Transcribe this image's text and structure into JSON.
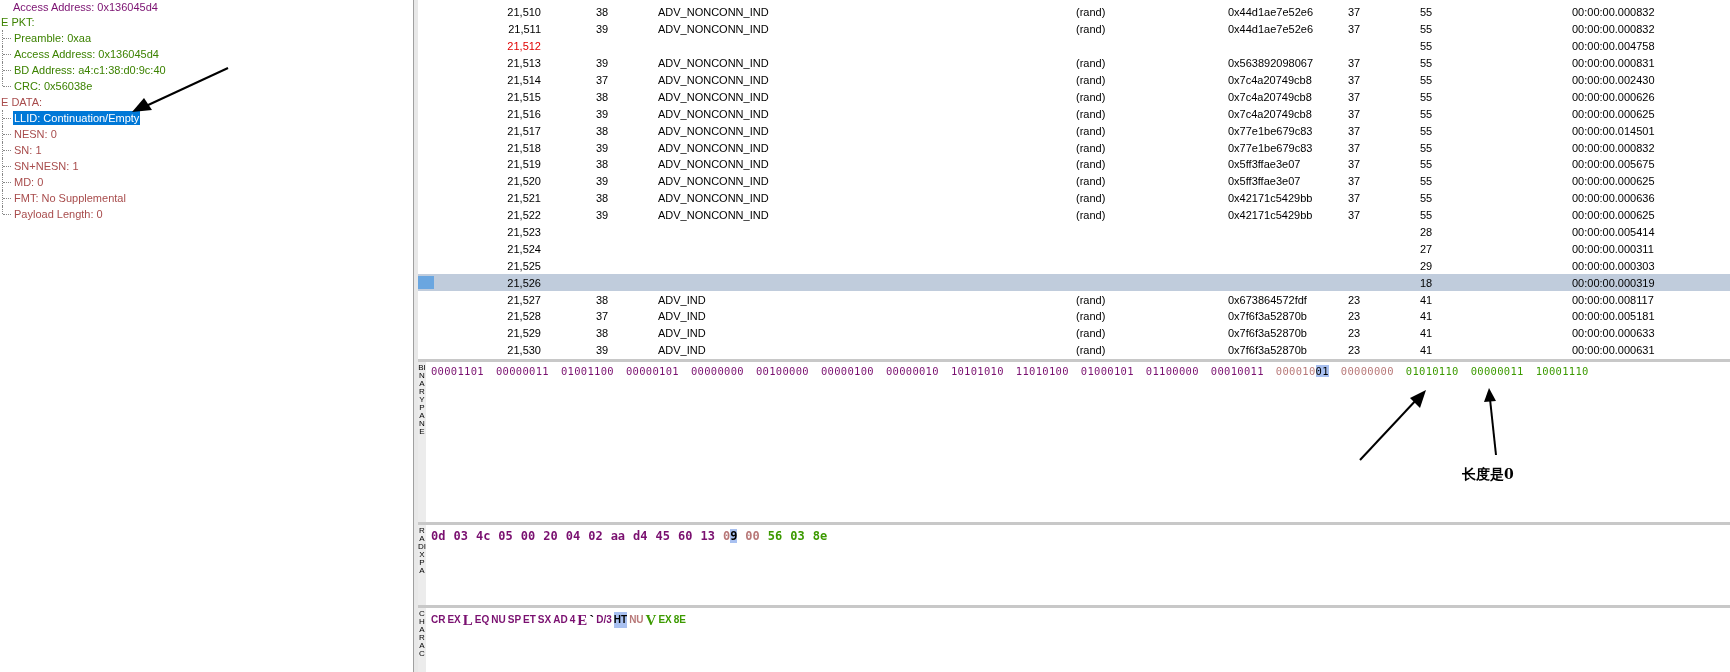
{
  "tree": [
    {
      "label": "Access Address: 0x136045d4",
      "color": "#7a1070",
      "selected": false
    },
    {
      "label": "E PKT:",
      "color": "#3c8200",
      "selected": false,
      "children": [
        {
          "label": "Preamble: 0xaa",
          "color": "#3c8200",
          "selected": false
        },
        {
          "label": "Access Address: 0x136045d4",
          "color": "#3c8200",
          "selected": false
        },
        {
          "label": "BD Address: a4:c1:38:d0:9c:40",
          "color": "#3c8200",
          "selected": false
        },
        {
          "label": "CRC: 0x56038e",
          "color": "#3c8200",
          "selected": false
        }
      ]
    },
    {
      "label": "E DATA:",
      "color": "#a84c4c",
      "selected": false,
      "children": [
        {
          "label": "LLID: Continuation/Empty",
          "selected": true
        },
        {
          "label": "NESN: 0",
          "color": "#a84c4c",
          "selected": false
        },
        {
          "label": "SN: 1",
          "color": "#a84c4c",
          "selected": false
        },
        {
          "label": "SN+NESN: 1",
          "color": "#a84c4c",
          "selected": false
        },
        {
          "label": "MD: 0",
          "color": "#a84c4c",
          "selected": false
        },
        {
          "label": "FMT: No Supplemental",
          "color": "#a84c4c",
          "selected": false
        },
        {
          "label": "Payload Length: 0",
          "color": "#a84c4c",
          "selected": false
        }
      ]
    }
  ],
  "table": {
    "rows": [
      {
        "index": "21,510",
        "column_2": "38",
        "pdu": "ADV_NONCONN_IND",
        "addr_type": "(rand)",
        "address": "0x44d1ae7e52e6",
        "column_6": "37",
        "column_7": "55",
        "time": "00:00:00.000832",
        "flagged": false,
        "selected": false
      },
      {
        "index": "21,511",
        "column_2": "39",
        "pdu": "ADV_NONCONN_IND",
        "addr_type": "(rand)",
        "address": "0x44d1ae7e52e6",
        "column_6": "37",
        "column_7": "55",
        "time": "00:00:00.000832",
        "flagged": false,
        "selected": false
      },
      {
        "index": "21,512",
        "column_7": "55",
        "time": "00:00:00.004758",
        "flagged": true,
        "selected": false
      },
      {
        "index": "21,513",
        "column_2": "39",
        "pdu": "ADV_NONCONN_IND",
        "addr_type": "(rand)",
        "address": "0x563892098067",
        "column_6": "37",
        "column_7": "55",
        "time": "00:00:00.000831",
        "flagged": false,
        "selected": false
      },
      {
        "index": "21,514",
        "column_2": "37",
        "pdu": "ADV_NONCONN_IND",
        "addr_type": "(rand)",
        "address": "0x7c4a20749cb8",
        "column_6": "37",
        "column_7": "55",
        "time": "00:00:00.002430",
        "flagged": false,
        "selected": false
      },
      {
        "index": "21,515",
        "column_2": "38",
        "pdu": "ADV_NONCONN_IND",
        "addr_type": "(rand)",
        "address": "0x7c4a20749cb8",
        "column_6": "37",
        "column_7": "55",
        "time": "00:00:00.000626",
        "flagged": false,
        "selected": false
      },
      {
        "index": "21,516",
        "column_2": "39",
        "pdu": "ADV_NONCONN_IND",
        "addr_type": "(rand)",
        "address": "0x7c4a20749cb8",
        "column_6": "37",
        "column_7": "55",
        "time": "00:00:00.000625",
        "flagged": false,
        "selected": false
      },
      {
        "index": "21,517",
        "column_2": "38",
        "pdu": "ADV_NONCONN_IND",
        "addr_type": "(rand)",
        "address": "0x77e1be679c83",
        "column_6": "37",
        "column_7": "55",
        "time": "00:00:00.014501",
        "flagged": false,
        "selected": false
      },
      {
        "index": "21,518",
        "column_2": "39",
        "pdu": "ADV_NONCONN_IND",
        "addr_type": "(rand)",
        "address": "0x77e1be679c83",
        "column_6": "37",
        "column_7": "55",
        "time": "00:00:00.000832",
        "flagged": false,
        "selected": false
      },
      {
        "index": "21,519",
        "column_2": "38",
        "pdu": "ADV_NONCONN_IND",
        "addr_type": "(rand)",
        "address": "0x5ff3ffae3e07",
        "column_6": "37",
        "column_7": "55",
        "time": "00:00:00.005675",
        "flagged": false,
        "selected": false
      },
      {
        "index": "21,520",
        "column_2": "39",
        "pdu": "ADV_NONCONN_IND",
        "addr_type": "(rand)",
        "address": "0x5ff3ffae3e07",
        "column_6": "37",
        "column_7": "55",
        "time": "00:00:00.000625",
        "flagged": false,
        "selected": false
      },
      {
        "index": "21,521",
        "column_2": "38",
        "pdu": "ADV_NONCONN_IND",
        "addr_type": "(rand)",
        "address": "0x42171c5429bb",
        "column_6": "37",
        "column_7": "55",
        "time": "00:00:00.000636",
        "flagged": false,
        "selected": false
      },
      {
        "index": "21,522",
        "column_2": "39",
        "pdu": "ADV_NONCONN_IND",
        "addr_type": "(rand)",
        "address": "0x42171c5429bb",
        "column_6": "37",
        "column_7": "55",
        "time": "00:00:00.000625",
        "flagged": false,
        "selected": false
      },
      {
        "index": "21,523",
        "column_7": "28",
        "time": "00:00:00.005414",
        "flagged": false,
        "selected": false
      },
      {
        "index": "21,524",
        "column_7": "27",
        "time": "00:00:00.000311",
        "flagged": false,
        "selected": false
      },
      {
        "index": "21,525",
        "column_7": "29",
        "time": "00:00:00.000303",
        "flagged": false,
        "selected": false
      },
      {
        "index": "21,526",
        "column_7": "18",
        "time": "00:00:00.000319",
        "flagged": false,
        "selected": true
      },
      {
        "index": "21,527",
        "column_2": "38",
        "pdu": "ADV_IND",
        "addr_type": "(rand)",
        "address": "0x673864572fdf",
        "column_6": "23",
        "column_7": "41",
        "time": "00:00:00.008117",
        "flagged": false,
        "selected": false
      },
      {
        "index": "21,528",
        "column_2": "37",
        "pdu": "ADV_IND",
        "addr_type": "(rand)",
        "address": "0x7f6f3a52870b",
        "column_6": "23",
        "column_7": "41",
        "time": "00:00:00.005181",
        "flagged": false,
        "selected": false
      },
      {
        "index": "21,529",
        "column_2": "38",
        "pdu": "ADV_IND",
        "addr_type": "(rand)",
        "address": "0x7f6f3a52870b",
        "column_6": "23",
        "column_7": "41",
        "time": "00:00:00.000633",
        "flagged": false,
        "selected": false
      },
      {
        "index": "21,530",
        "column_2": "39",
        "pdu": "ADV_IND",
        "addr_type": "(rand)",
        "address": "0x7f6f3a52870b",
        "column_6": "23",
        "column_7": "41",
        "time": "00:00:00.000631",
        "flagged": false,
        "selected": false
      }
    ]
  },
  "binary_pane": {
    "label": "BINARY PANE",
    "bytes": [
      {
        "text": "00001101",
        "color": "#7a1070"
      },
      {
        "text": "00000011",
        "color": "#7a1070"
      },
      {
        "text": "01001100",
        "color": "#7a1070"
      },
      {
        "text": "00000101",
        "color": "#7a1070"
      },
      {
        "text": "00000000",
        "color": "#7a1070"
      },
      {
        "text": "00100000",
        "color": "#7a1070"
      },
      {
        "text": "00000100",
        "color": "#7a1070"
      },
      {
        "text": "00000010",
        "color": "#7a1070"
      },
      {
        "text": "10101010",
        "color": "#7a1070"
      },
      {
        "text": "11010100",
        "color": "#7a1070"
      },
      {
        "text": "01000101",
        "color": "#7a1070"
      },
      {
        "text": "01100000",
        "color": "#7a1070"
      },
      {
        "text": "00010011",
        "color": "#7a1070"
      },
      {
        "text": "000010",
        "highlight": "01",
        "color": "#b87878"
      },
      {
        "text": "00000000",
        "color": "#b87878"
      },
      {
        "text": "01010110",
        "color": "#3c9a00"
      },
      {
        "text": "00000011",
        "color": "#3c9a00"
      },
      {
        "text": "10001110",
        "color": "#3c9a00"
      }
    ],
    "annotation": "长度是0"
  },
  "radix_pane": {
    "label": "RADIX PA",
    "bytes": [
      {
        "text": "0d",
        "color": "#7a1070"
      },
      {
        "text": "03",
        "color": "#7a1070"
      },
      {
        "text": "4c",
        "color": "#7a1070"
      },
      {
        "text": "05",
        "color": "#7a1070"
      },
      {
        "text": "00",
        "color": "#7a1070"
      },
      {
        "text": "20",
        "color": "#7a1070"
      },
      {
        "text": "04",
        "color": "#7a1070"
      },
      {
        "text": "02",
        "color": "#7a1070"
      },
      {
        "text": "aa",
        "color": "#7a1070"
      },
      {
        "text": "d4",
        "color": "#7a1070"
      },
      {
        "text": "45",
        "color": "#7a1070"
      },
      {
        "text": "60",
        "color": "#7a1070"
      },
      {
        "text": "13",
        "color": "#7a1070"
      },
      {
        "text": "0",
        "highlight": "9",
        "color": "#b87878"
      },
      {
        "text": "00",
        "color": "#b87878"
      },
      {
        "text": "56",
        "color": "#3c9a00"
      },
      {
        "text": "03",
        "color": "#3c9a00"
      },
      {
        "text": "8e",
        "color": "#3c9a00"
      }
    ]
  },
  "character_pane": {
    "label": "CHARAC",
    "glyphs": [
      {
        "text": "CR",
        "kind": "ctl",
        "color": "#7a1070"
      },
      {
        "text": "EX",
        "kind": "ctl",
        "color": "#7a1070"
      },
      {
        "text": "L",
        "kind": "chr",
        "color": "#7a1070"
      },
      {
        "text": "EQ",
        "kind": "ctl",
        "color": "#7a1070"
      },
      {
        "text": "NU",
        "kind": "ctl",
        "color": "#7a1070"
      },
      {
        "text": "SP",
        "kind": "ctl",
        "color": "#7a1070"
      },
      {
        "text": "ET",
        "kind": "ctl",
        "color": "#7a1070"
      },
      {
        "text": "SX",
        "kind": "ctl",
        "color": "#7a1070"
      },
      {
        "text": "AD",
        "kind": "ctl",
        "color": "#7a1070"
      },
      {
        "text": "4",
        "kind": "ctl",
        "color": "#7a1070"
      },
      {
        "text": "E",
        "kind": "chr",
        "color": "#7a1070"
      },
      {
        "text": "`",
        "kind": "chr"
      },
      {
        "text": "D/3",
        "kind": "ctl",
        "color": "#7a1070"
      },
      {
        "text": "HT",
        "kind": "ctl",
        "selected": true
      },
      {
        "text": "NU",
        "kind": "ctl",
        "color": "#b87878",
        "selected": false
      },
      {
        "text": "V",
        "kind": "chr",
        "color": "#3c9a00"
      },
      {
        "text": "EX",
        "kind": "ctl",
        "color": "#3c9a00"
      },
      {
        "text": "8E",
        "kind": "ctl",
        "color": "#3c9a00"
      }
    ]
  }
}
